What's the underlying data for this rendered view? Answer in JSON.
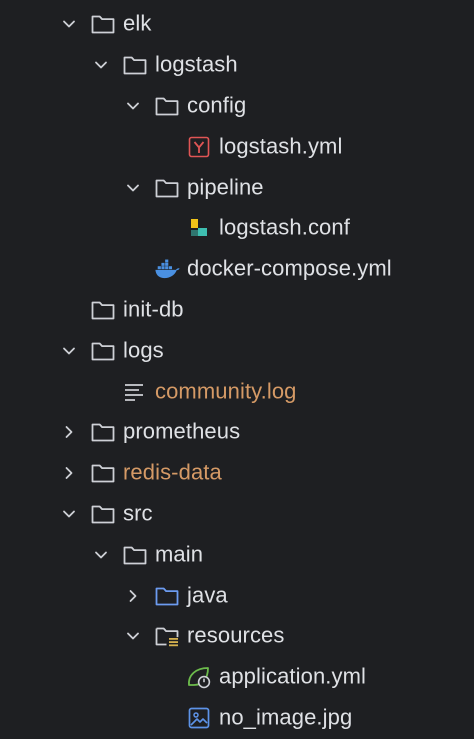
{
  "project_tree": {
    "items": [
      {
        "label": "elk",
        "level": 1,
        "expand": "open",
        "icon": "folder-icon",
        "color": "#dfe1e5"
      },
      {
        "label": "logstash",
        "level": 2,
        "expand": "open",
        "icon": "folder-icon",
        "color": "#dfe1e5"
      },
      {
        "label": "config",
        "level": 3,
        "expand": "open",
        "icon": "folder-icon",
        "color": "#dfe1e5"
      },
      {
        "label": "logstash.yml",
        "level": 4,
        "expand": "none",
        "icon": "yaml-file-icon",
        "color": "#dfe1e5"
      },
      {
        "label": "pipeline",
        "level": 3,
        "expand": "open",
        "icon": "folder-icon",
        "color": "#dfe1e5"
      },
      {
        "label": "logstash.conf",
        "level": 4,
        "expand": "none",
        "icon": "logstash-conf-icon",
        "color": "#dfe1e5"
      },
      {
        "label": "docker-compose.yml",
        "level": 3,
        "expand": "none",
        "icon": "docker-icon",
        "color": "#dfe1e5"
      },
      {
        "label": "init-db",
        "level": 1,
        "expand": "none",
        "icon": "folder-icon",
        "color": "#dfe1e5"
      },
      {
        "label": "logs",
        "level": 1,
        "expand": "open",
        "icon": "folder-icon",
        "color": "#dfe1e5"
      },
      {
        "label": "community.log",
        "level": 2,
        "expand": "none",
        "icon": "log-file-icon",
        "color": "#d59a66"
      },
      {
        "label": "prometheus",
        "level": 1,
        "expand": "closed",
        "icon": "folder-icon",
        "color": "#dfe1e5"
      },
      {
        "label": "redis-data",
        "level": 1,
        "expand": "closed",
        "icon": "folder-icon",
        "color": "#d59a66"
      },
      {
        "label": "src",
        "level": 1,
        "expand": "open",
        "icon": "folder-icon",
        "color": "#dfe1e5"
      },
      {
        "label": "main",
        "level": 2,
        "expand": "open",
        "icon": "folder-icon",
        "color": "#dfe1e5"
      },
      {
        "label": "java",
        "level": 3,
        "expand": "closed",
        "icon": "source-folder-icon",
        "color": "#dfe1e5"
      },
      {
        "label": "resources",
        "level": 3,
        "expand": "open",
        "icon": "resources-folder-icon",
        "color": "#dfe1e5"
      },
      {
        "label": "application.yml",
        "level": 4,
        "expand": "none",
        "icon": "spring-config-icon",
        "color": "#dfe1e5"
      },
      {
        "label": "no_image.jpg",
        "level": 4,
        "expand": "none",
        "icon": "image-file-icon",
        "color": "#dfe1e5"
      }
    ]
  }
}
